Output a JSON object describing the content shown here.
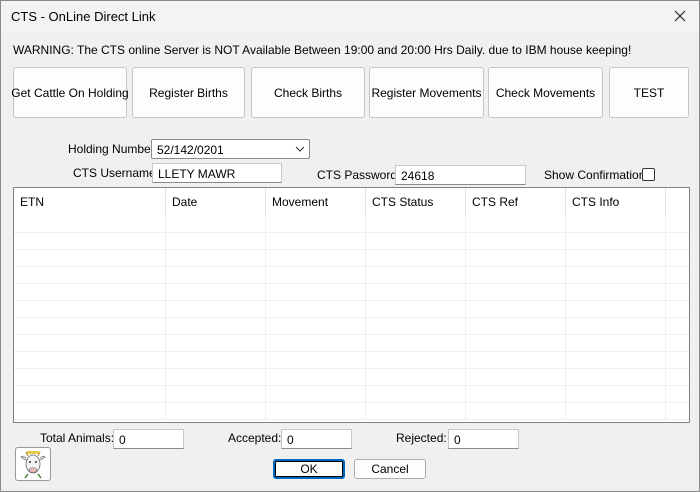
{
  "window": {
    "title": "CTS - OnLine Direct Link"
  },
  "warning": "WARNING: The CTS online Server is NOT Available Between 19:00 and 20:00 Hrs Daily. due to IBM house keeping!",
  "toolbar": {
    "get_cattle": "Get Cattle On Holding",
    "register_births": "Register Births",
    "check_births": "Check Births",
    "register_movements": "Register Movements",
    "check_movements": "Check Movements",
    "test": "TEST"
  },
  "form": {
    "holding_label": "Holding Number:",
    "holding_value": "52/142/0201",
    "username_label": "CTS Username:",
    "username_value": "LLETY MAWR",
    "password_label": "CTS Password:",
    "password_value": "24618",
    "show_confirmation_label": "Show Confirmation:",
    "show_confirmation_checked": false
  },
  "grid": {
    "columns": [
      "ETN",
      "Date",
      "Movement",
      "CTS Status",
      "CTS Ref",
      "CTS Info"
    ],
    "rows": []
  },
  "totals": {
    "total_label": "Total Animals:",
    "total_value": "0",
    "accepted_label": "Accepted:",
    "accepted_value": "0",
    "rejected_label": "Rejected:",
    "rejected_value": "0"
  },
  "buttons": {
    "ok": "OK",
    "cancel": "Cancel"
  },
  "colors": {
    "accent": "#0067c0",
    "window_bg": "#f0f0f0"
  }
}
